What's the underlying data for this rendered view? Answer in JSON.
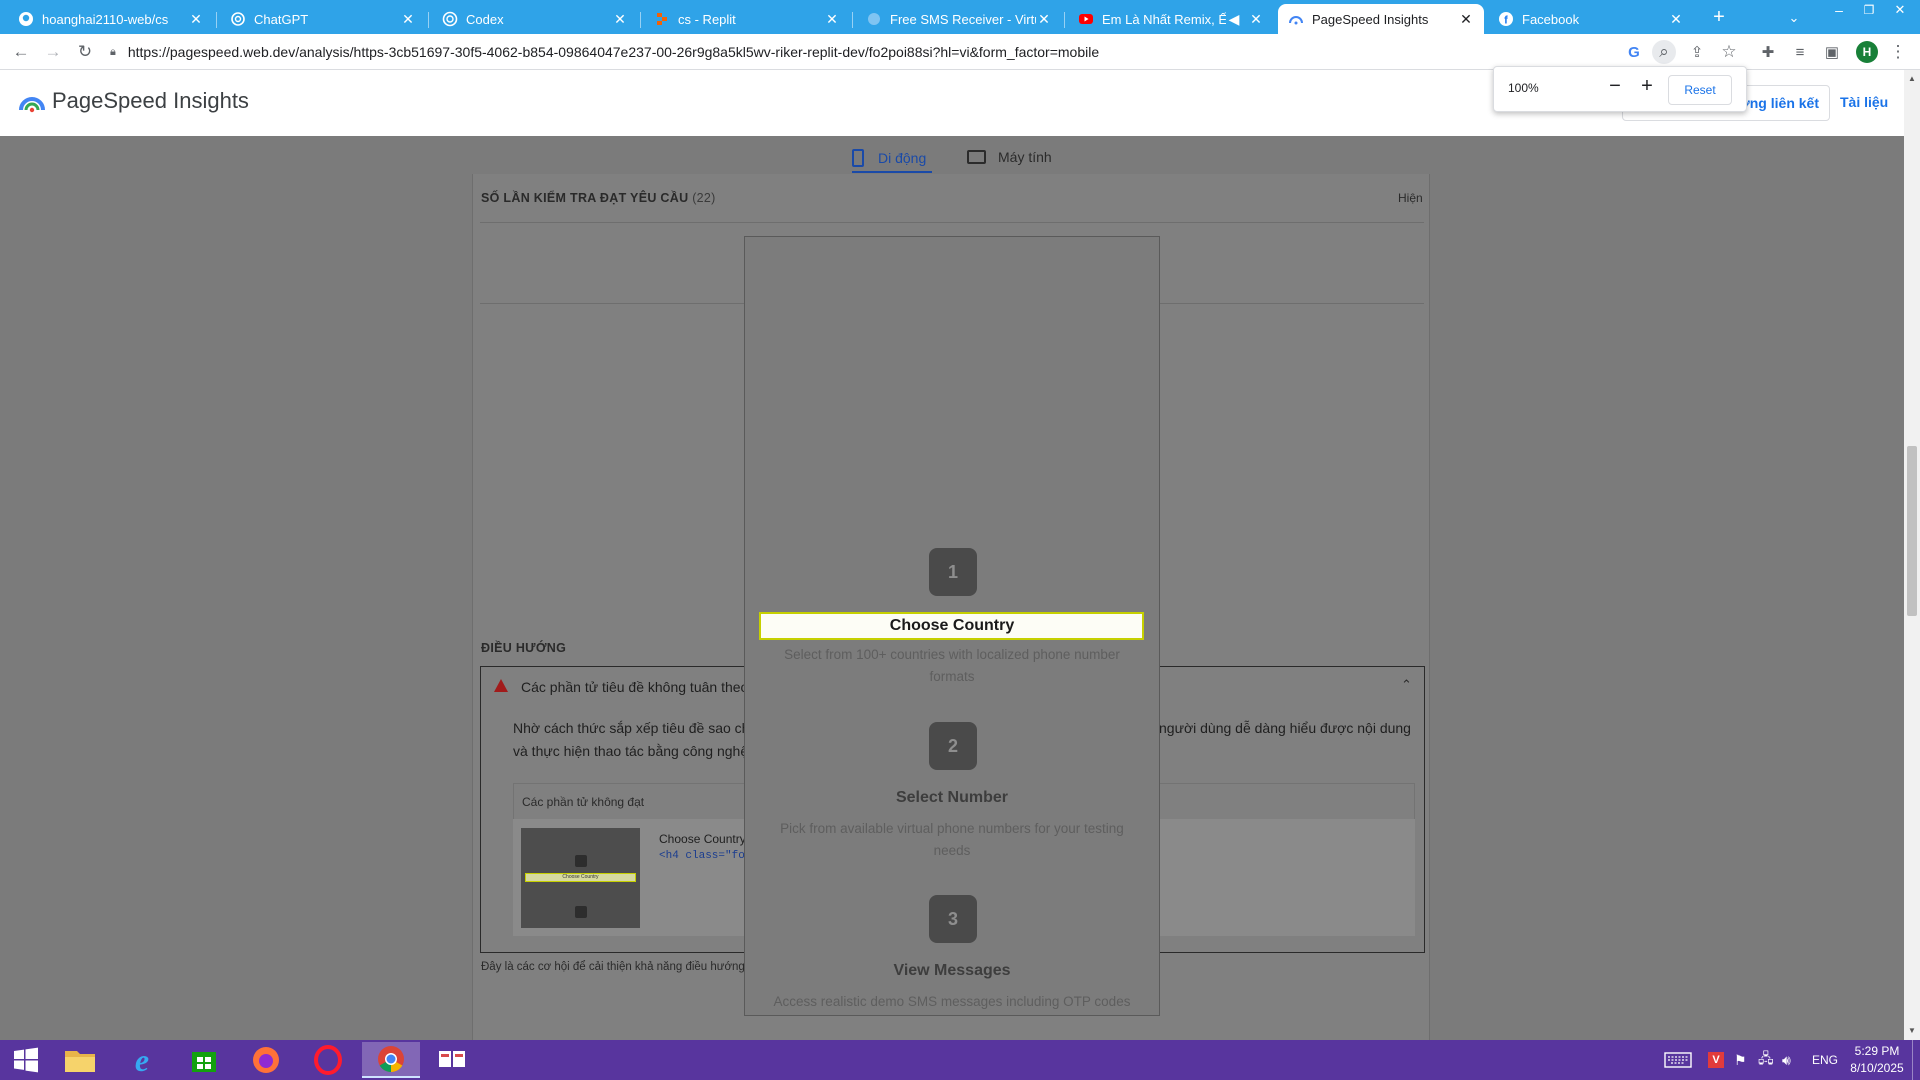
{
  "tabs": [
    {
      "title": "hoanghai2110-web/cs",
      "icon": "github-icon"
    },
    {
      "title": "ChatGPT",
      "icon": "chatgpt-icon"
    },
    {
      "title": "Codex",
      "icon": "codex-icon"
    },
    {
      "title": "cs - Replit",
      "icon": "replit-icon"
    },
    {
      "title": "Free SMS Receiver - Virtual",
      "icon": "globe-icon"
    },
    {
      "title": "Em Là Nhất Remix, Ếy T",
      "icon": "youtube-icon"
    },
    {
      "title": "PageSpeed Insights",
      "icon": "pagespeed-icon"
    },
    {
      "title": "Facebook",
      "icon": "facebook-icon"
    }
  ],
  "omnibox": {
    "url": "https://pagespeed.web.dev/analysis/https-3cb51697-30f5-4062-b854-09864047e237-00-26r9g8a5kl5wv-riker-replit-dev/fo2poi88si?hl=vi&form_factor=mobile"
  },
  "profile": {
    "initial": "H"
  },
  "zoom_popup": {
    "level": "100%",
    "minus": "−",
    "plus": "+",
    "reset": "Reset"
  },
  "header": {
    "logo_text": "PageSpeed Insights",
    "copy_link": "Sao chép đường liên kết",
    "docs": "Tài liệu"
  },
  "form_factor": {
    "mobile": "Di động",
    "desktop": "Máy tính"
  },
  "passed": {
    "label": "SỐ LẦN KIỂM TRA ĐẠT YÊU CẦU",
    "count": "(22)",
    "show": "Hiện"
  },
  "navigation": {
    "section_title": "ĐIỀU HƯỚNG",
    "audit_title": "Các phần tử tiêu đề không tuân theo thứ tự giảm dần",
    "desc_line1_left": "Nhờ cách thức sắp xếp tiêu đề sao cho",
    "desc_line1_right": "người dùng dễ dàng hiểu được nội dung",
    "desc_line2": "và thực hiện thao tác bằng công nghệ",
    "failing_header": "Các phần tử không đạt",
    "element_label": "Choose Country",
    "element_code": "<h4 class=\"fo",
    "footer_note": "Đây là các cơ hội để cải thiện khả năng điều hướng bằng bàn phím trong ứng dụng của bạn."
  },
  "phone": {
    "steps": [
      {
        "num": "1",
        "title": "Choose Country",
        "desc": "Select from 100+ countries with localized phone number formats"
      },
      {
        "num": "2",
        "title": "Select Number",
        "desc": "Pick from available virtual phone numbers for your testing needs"
      },
      {
        "num": "3",
        "title": "View Messages",
        "desc": "Access realistic demo SMS messages including OTP codes"
      }
    ]
  },
  "thumb": {
    "label": "Choose Country"
  },
  "taskbar": {
    "apps": [
      "windows-start-icon",
      "file-explorer-icon",
      "internet-explorer-icon",
      "store-icon",
      "firefox-icon",
      "opera-icon",
      "chrome-icon",
      "app-icon"
    ],
    "lang": "ENG",
    "time": "5:29 PM",
    "date": "8/10/2025"
  },
  "colors": {
    "tabstrip": "#2fa3e8",
    "taskbar": "#58359e",
    "link_blue": "#1a73e8",
    "overlay": "#7b7b7b",
    "highlight_border": "#c6d000"
  }
}
